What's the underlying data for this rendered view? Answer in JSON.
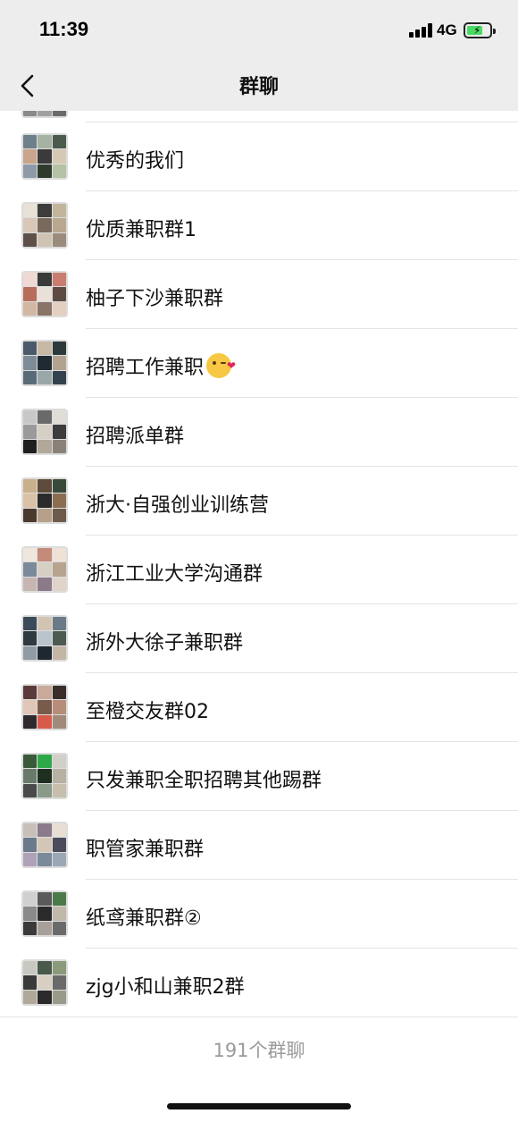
{
  "status_bar": {
    "time": "11:39",
    "network": "4G",
    "battery_level": 0.7,
    "battery_color": "#4cd964"
  },
  "nav": {
    "title": "群聊",
    "back_icon": "chevron-left-icon"
  },
  "groups": [
    {
      "name": "优秀的我们",
      "avatar": [
        "#6d7f8a",
        "#a7b3a2",
        "#4b5a4d",
        "#c9a58b",
        "#3a3a3a",
        "#d6c9b4",
        "#8e9aa8",
        "#2f3a2c",
        "#b5c2a3"
      ]
    },
    {
      "name": "优质兼职群1",
      "avatar": [
        "#e8e2d6",
        "#3c3c3c",
        "#c2b59b",
        "#d9c7b8",
        "#7a6a5d",
        "#b9a88f",
        "#5e5048",
        "#cfc4b2",
        "#9a8b7c"
      ]
    },
    {
      "name": "柚子下沙兼职群",
      "avatar": [
        "#f0d9d2",
        "#3a3a3a",
        "#c97d6e",
        "#b86c5a",
        "#e9e0d7",
        "#5d4a43",
        "#d2b7a3",
        "#8a7367",
        "#e4cfc1"
      ]
    },
    {
      "name": "招聘工作兼职",
      "emoji": "kissing-face-emoji",
      "avatar": [
        "#4a5a6a",
        "#c7b8a4",
        "#2d3a3a",
        "#7d8c96",
        "#1f2a33",
        "#b2a390",
        "#5a6b78",
        "#9aa7a9",
        "#34424d"
      ]
    },
    {
      "name": "招聘派单群",
      "avatar": [
        "#c8c8c8",
        "#6a6a6a",
        "#e0ddd6",
        "#9a9a9a",
        "#d5cfc5",
        "#3c3c3c",
        "#1f1f1f",
        "#b0a898",
        "#8a8278"
      ]
    },
    {
      "name": "浙大·自强创业训练营",
      "avatar": [
        "#c9b08c",
        "#5e4a3a",
        "#3a4a3a",
        "#d9c2a5",
        "#2a2a2a",
        "#8b6d50",
        "#4a3a2e",
        "#b7a089",
        "#6d5a4a"
      ]
    },
    {
      "name": "浙江工业大学沟通群",
      "avatar": [
        "#efe6dc",
        "#c48a7a",
        "#f0e1d6",
        "#7a8a9a",
        "#d6d0c4",
        "#b7a48f",
        "#c6b5b0",
        "#8a7a8a",
        "#e0d3c9"
      ]
    },
    {
      "name": "浙外大徐子兼职群",
      "avatar": [
        "#3a4a5a",
        "#d1c4b3",
        "#6a7a86",
        "#2e3a40",
        "#b9c4cc",
        "#4d5a52",
        "#8f9ca6",
        "#1d2830",
        "#c4b6a4"
      ]
    },
    {
      "name": "至橙交友群02",
      "avatar": [
        "#5a3a3a",
        "#c9a99a",
        "#3a2e2a",
        "#e0c6b6",
        "#7a5a4a",
        "#b78d7a",
        "#2e2a2e",
        "#d85a4a",
        "#a08a7a"
      ]
    },
    {
      "name": "只发兼职全职招聘其他踢群",
      "avatar": [
        "#3a5a3a",
        "#2fa84a",
        "#d0d0c8",
        "#6a7a6a",
        "#1f2f1f",
        "#b8b0a0",
        "#4a4a4a",
        "#8a9a8a",
        "#c7bfae"
      ]
    },
    {
      "name": "职管家兼职群",
      "avatar": [
        "#c8c0b8",
        "#8a7a8a",
        "#e8ded4",
        "#6a7a8a",
        "#d4c6b6",
        "#4a4a5a",
        "#b0a2b6",
        "#7a8a9a",
        "#9aa8b6"
      ]
    },
    {
      "name": "纸鸢兼职群②",
      "avatar": [
        "#d0d0d0",
        "#5a5a5a",
        "#4a7a4a",
        "#8a8a8a",
        "#2a2a2a",
        "#c0b8a8",
        "#3a3a3a",
        "#a8a098",
        "#6a6a6a"
      ]
    },
    {
      "name": "zjg小和山兼职2群",
      "avatar": [
        "#c8c8c0",
        "#4a5a4a",
        "#8a9a7a",
        "#3a3a3a",
        "#d6cfc2",
        "#6a6a6a",
        "#b0a898",
        "#2a2a2a",
        "#9a9a8a"
      ]
    }
  ],
  "footer": {
    "count_text": "191个群聊"
  },
  "colors": {
    "header_bg": "#ededed",
    "divider": "#e4e4e4",
    "count_text": "#9a9a9a"
  }
}
